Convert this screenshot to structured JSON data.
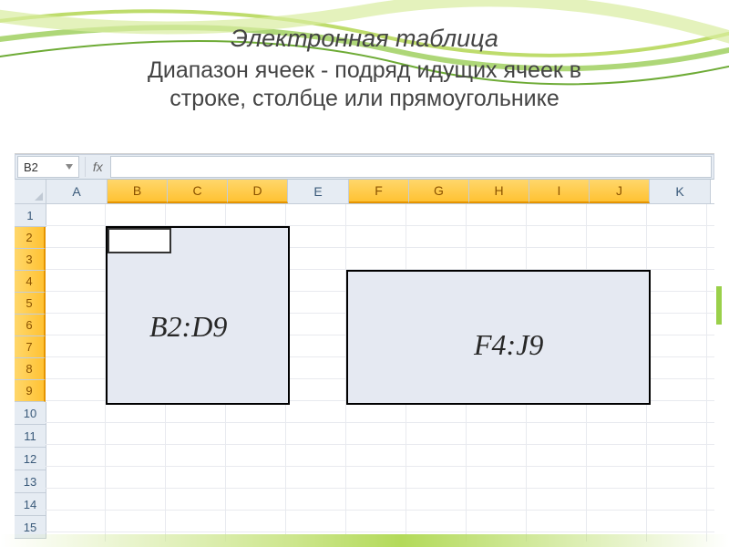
{
  "heading": {
    "title": "Электронная таблица",
    "sub1": "Диапазон ячеек - подряд идущих ячеек в",
    "sub2": "строке, столбце или прямоугольнике"
  },
  "namebox": "B2",
  "columns": [
    "A",
    "B",
    "C",
    "D",
    "E",
    "F",
    "G",
    "H",
    "I",
    "J",
    "K"
  ],
  "selectedCols": [
    "B",
    "C",
    "D",
    "F",
    "G",
    "H",
    "I",
    "J"
  ],
  "rows": [
    "1",
    "2",
    "3",
    "4",
    "5",
    "6",
    "7",
    "8",
    "9",
    "10",
    "11",
    "12",
    "13",
    "14",
    "15"
  ],
  "selectedRows": [
    "2",
    "3",
    "4",
    "5",
    "6",
    "7",
    "8",
    "9"
  ],
  "rangeA": "B2:D9",
  "rangeB": "F4:J9"
}
